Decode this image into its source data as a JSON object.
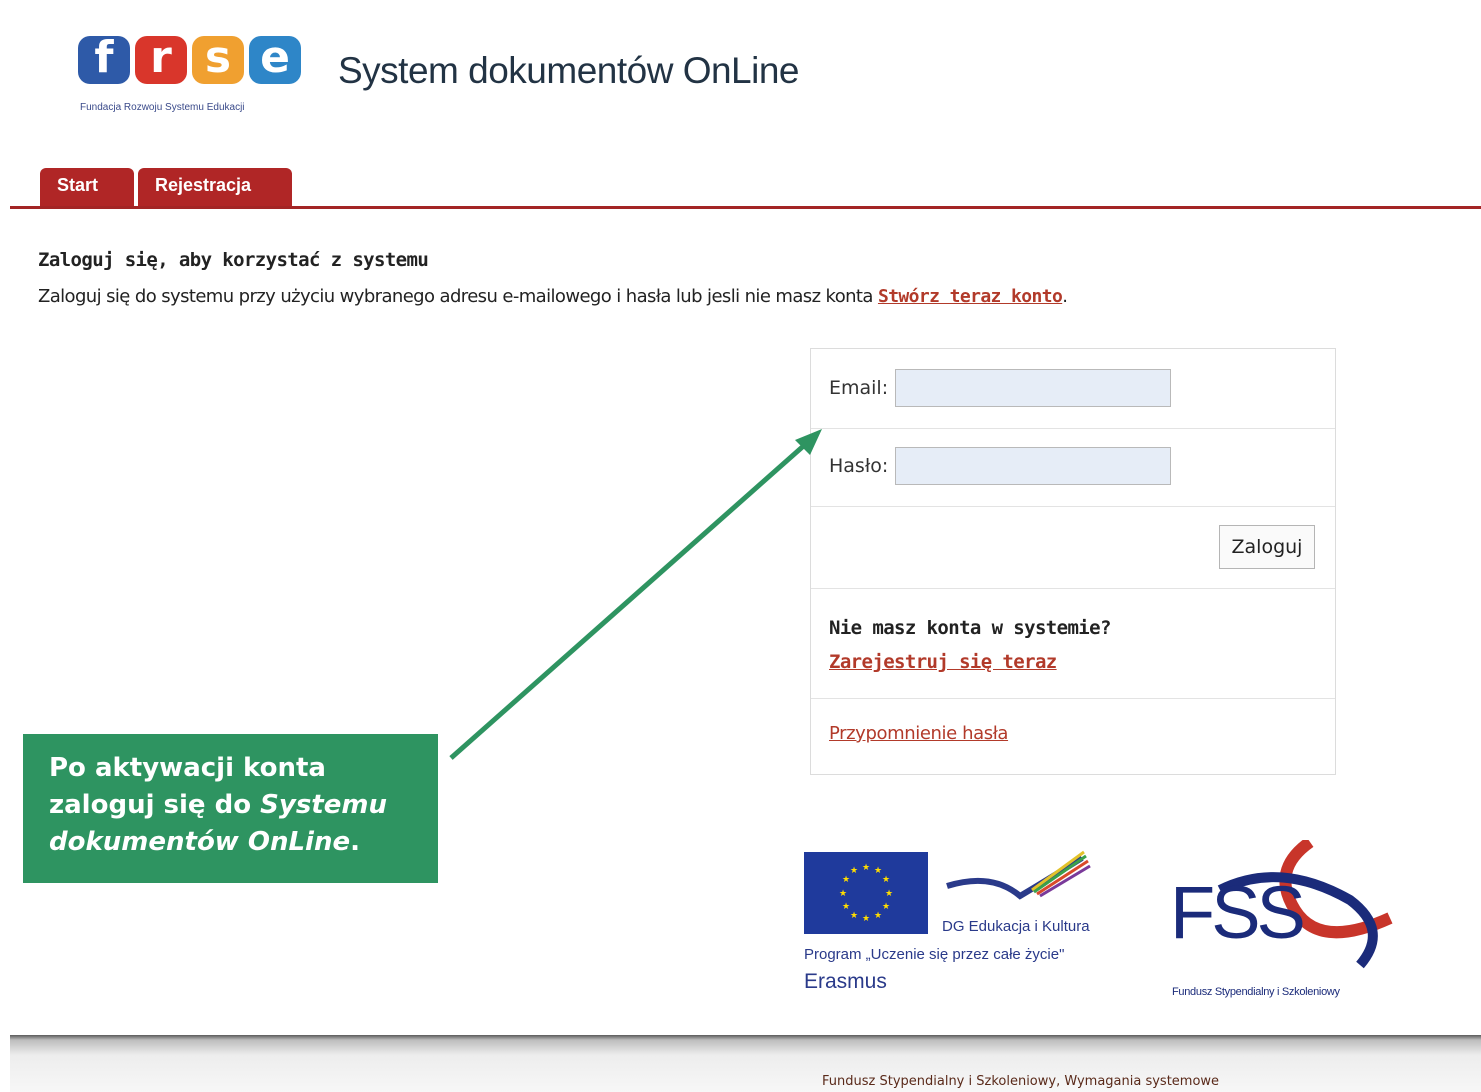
{
  "header": {
    "logo_letters": [
      "f",
      "r",
      "s",
      "e"
    ],
    "logo_colors": [
      "#2e5aa8",
      "#d9362b",
      "#f0a030",
      "#2e86c8"
    ],
    "logo_caption": "Fundacja Rozwoju Systemu Edukacji",
    "app_title": "System dokumentów OnLine"
  },
  "tabs": [
    {
      "label": "Start"
    },
    {
      "label": "Rejestracja"
    }
  ],
  "intro": {
    "heading": "Zaloguj się, aby korzystać z systemu",
    "text": "Zaloguj się do systemu przy użyciu wybranego adresu e-mailowego i hasła lub jesli nie masz konta ",
    "link": "Stwórz teraz konto",
    "end": "."
  },
  "login": {
    "email_label": "Email:",
    "email_value": "",
    "password_label": "Hasło:",
    "password_value": "",
    "submit_label": "Zaloguj",
    "no_account_title": "Nie masz konta w systemie?",
    "register_link": "Zarejestruj się teraz",
    "remind_link": "Przypomnienie hasła"
  },
  "callout": {
    "line1": "Po aktywacji konta",
    "line2_start": "zaloguj się do ",
    "line2_italic": "Systemu",
    "line3_italic": "dokumentów OnLine",
    "line3_end": "."
  },
  "eu_logo": {
    "dg_text": "DG Edukacja i Kultura",
    "program_text": "Program „Uczenie się przez całe życie\"",
    "erasmus_text": "Erasmus"
  },
  "fss_logo": {
    "letters": "FSS",
    "caption": "Fundusz Stypendialny i Szkoleniowy"
  },
  "footer": {
    "text": "Fundusz Stypendialny i Szkoleniowy, Wymagania systemowe"
  },
  "colors": {
    "tab_red": "#b02626",
    "link_red": "#b23a2a",
    "callout_green": "#2e9461",
    "eu_blue": "#1f3a9c"
  }
}
